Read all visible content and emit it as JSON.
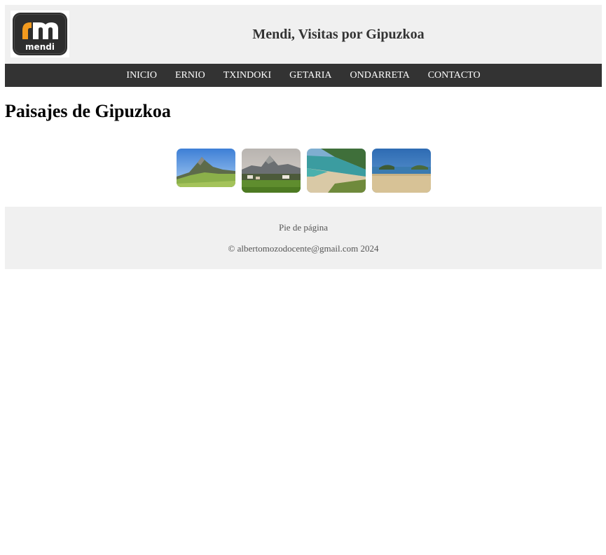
{
  "header": {
    "logo_alt": "mendi",
    "logo_text": "mendi",
    "title": "Mendi, Visitas por Gipuzkoa"
  },
  "nav": {
    "items": [
      "INICIO",
      "ERNIO",
      "TXINDOKI",
      "GETARIA",
      "ONDARRETA",
      "CONTACTO"
    ]
  },
  "main": {
    "title": "Paisajes de Gipuzkoa",
    "gallery": [
      {
        "icon": "ernio-landscape-image"
      },
      {
        "icon": "txindoki-landscape-image"
      },
      {
        "icon": "getaria-beach-image"
      },
      {
        "icon": "ondarreta-beach-image"
      }
    ]
  },
  "footer": {
    "line1": "Pie de página",
    "line2": "© albertomozodocente@gmail.com 2024"
  },
  "colors": {
    "header_bg": "#f0f0f0",
    "nav_bg": "#333333",
    "logo_accent": "#f39a1e",
    "logo_dark": "#2e2e2e"
  }
}
